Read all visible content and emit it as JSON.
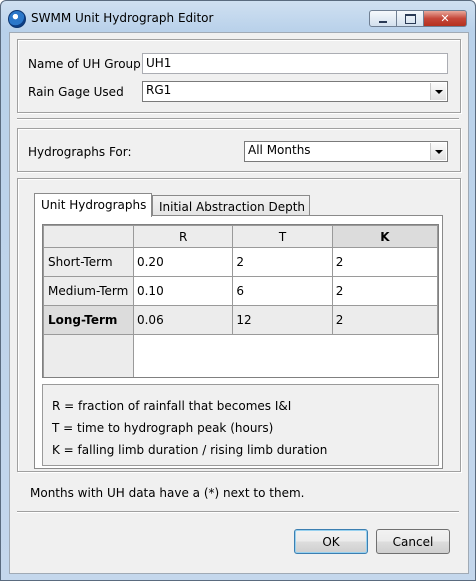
{
  "window": {
    "title": "SWMM Unit Hydrograph Editor"
  },
  "group": {
    "name_label": "Name of UH Group",
    "name_value": "UH1",
    "raingage_label": "Rain Gage Used",
    "raingage_value": "RG1"
  },
  "hydrographs_for": {
    "label": "Hydrographs For:",
    "value": "All Months"
  },
  "tabs": [
    {
      "label": "Unit Hydrographs",
      "active": true
    },
    {
      "label": "Initial Abstraction Depth",
      "active": false
    }
  ],
  "grid": {
    "columns": [
      "R",
      "T",
      "K"
    ],
    "rows": [
      {
        "label": "Short-Term",
        "values": [
          "0.20",
          "2",
          "2"
        ]
      },
      {
        "label": "Medium-Term",
        "values": [
          "0.10",
          "6",
          "2"
        ]
      },
      {
        "label": "Long-Term",
        "values": [
          "0.06",
          "12",
          "2"
        ]
      }
    ]
  },
  "legend": {
    "line1": "R = fraction of rainfall that becomes I&I",
    "line2": "T = time to hydrograph peak (hours)",
    "line3": "K = falling limb duration / rising limb duration"
  },
  "note": "Months with UH data have a (*) next to them.",
  "buttons": {
    "ok": "OK",
    "cancel": "Cancel"
  },
  "icons": [
    "app-icon",
    "minimize-icon",
    "maximize-icon",
    "close-icon",
    "dropdown-arrow-icon"
  ]
}
